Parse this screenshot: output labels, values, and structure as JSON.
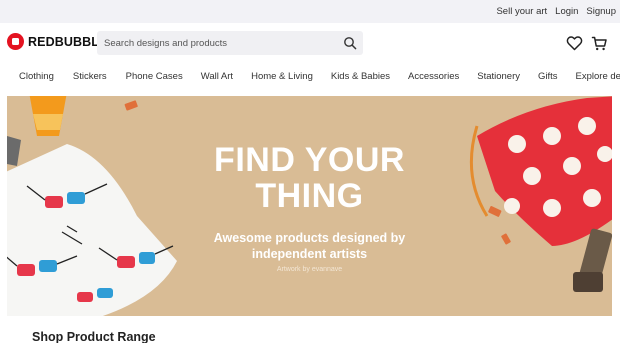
{
  "topbar": {
    "sell_label": "Sell your art",
    "login_label": "Login",
    "signup_label": "Signup"
  },
  "header": {
    "brand": "REDBUBBLE",
    "search_placeholder": "Search designs and products",
    "icons": [
      "search-icon",
      "heart-icon",
      "cart-icon"
    ]
  },
  "nav": {
    "items": [
      "Clothing",
      "Stickers",
      "Phone Cases",
      "Wall Art",
      "Home & Living",
      "Kids & Babies",
      "Accessories",
      "Stationery",
      "Gifts",
      "Explore designs"
    ]
  },
  "hero": {
    "headline_line1": "FIND YOUR",
    "headline_line2": "THING",
    "sub_line1": "Awesome products designed by",
    "sub_line2": "independent artists",
    "credit": "Artwork by evannave",
    "background_color": "#d9bc95"
  },
  "main": {
    "section_title": "Shop Product Range"
  },
  "colors": {
    "brand": "#e41321",
    "topbar_bg": "#f2f2f6",
    "search_bg": "#f0f0f3"
  }
}
